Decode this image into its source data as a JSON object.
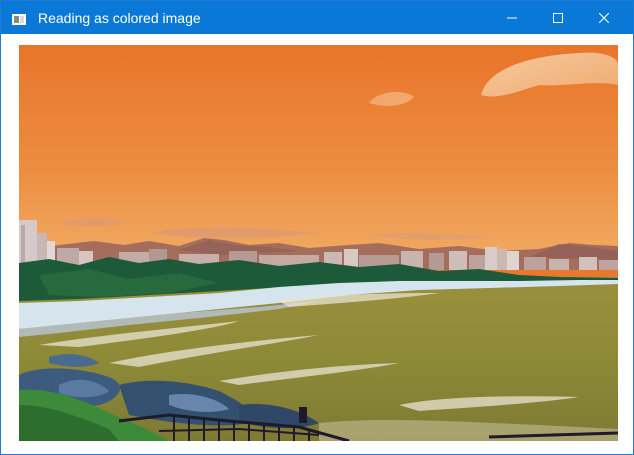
{
  "window": {
    "title": "Reading as colored image"
  },
  "title_bar": {
    "icons": [
      "app-window-icon",
      "minimize-icon",
      "maximize-icon",
      "close-icon"
    ]
  },
  "image": {
    "subject": "coastal-beach-photo",
    "colors": {
      "sky_top": "#e8752a",
      "sky_bottom": "#f1aa63",
      "sea": "#8d8a38",
      "sand": "#d6e4ee",
      "foliage": "#1c5a3a",
      "mountains": "#a56d5c",
      "rocks": "#3d5a7f"
    }
  }
}
